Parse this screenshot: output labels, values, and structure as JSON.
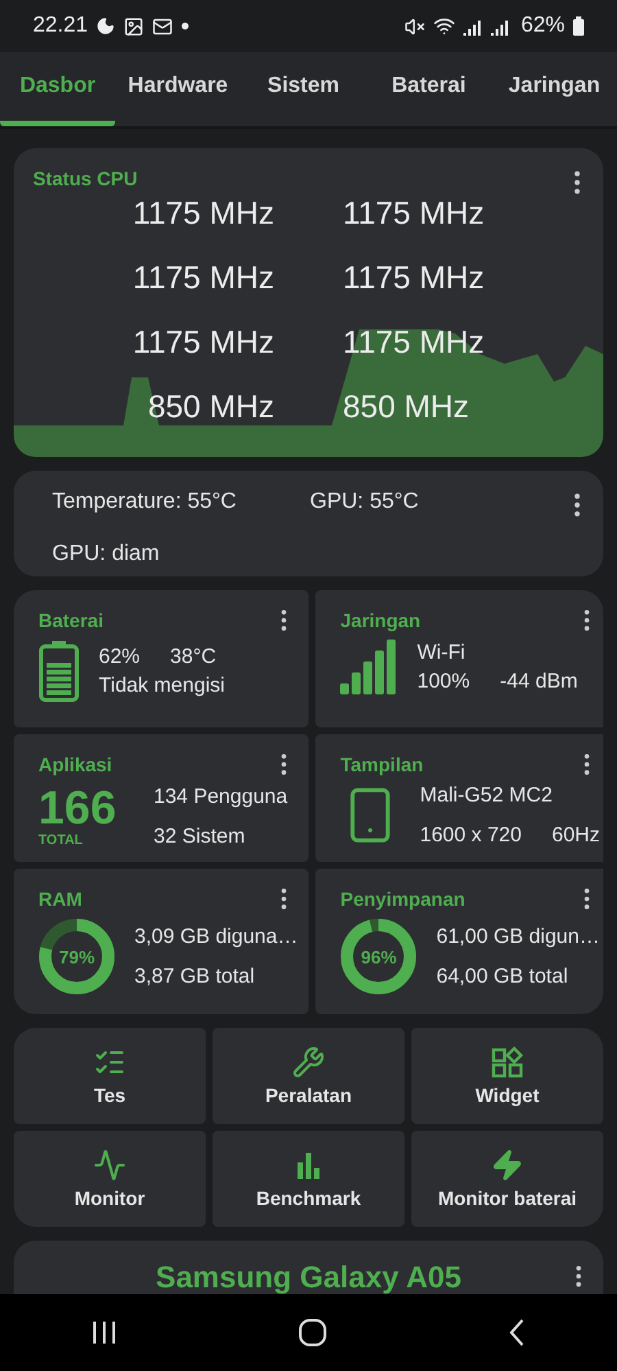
{
  "status_bar": {
    "time": "22.21",
    "battery": "62%"
  },
  "tabs": [
    {
      "label": "Dasbor",
      "selected": true
    },
    {
      "label": "Hardware",
      "selected": false
    },
    {
      "label": "Sistem",
      "selected": false
    },
    {
      "label": "Baterai",
      "selected": false
    },
    {
      "label": "Jaringan",
      "selected": false
    }
  ],
  "cpu_status": {
    "title": "Status CPU",
    "frequencies": [
      "1175 MHz",
      "1175 MHz",
      "1175 MHz",
      "1175 MHz",
      "1175 MHz",
      "1175 MHz",
      "850 MHz",
      "850 MHz"
    ]
  },
  "temperature": {
    "items": [
      "Temperature: 55°C",
      "GPU: 55°C",
      "GPU: diam"
    ]
  },
  "cards": [
    {
      "kind": "battery",
      "title": "Baterai",
      "lines": [
        [
          "62%",
          "38°C"
        ],
        [
          "Tidak mengisi"
        ]
      ]
    },
    {
      "kind": "network",
      "title": "Jaringan",
      "lines": [
        [
          "Wi-Fi"
        ],
        [
          "100%",
          "-44 dBm"
        ]
      ]
    },
    {
      "kind": "apps",
      "title": "Aplikasi",
      "count": "166",
      "count_label": "TOTAL",
      "lines": [
        [
          "134 Pengguna"
        ],
        [
          "32 Sistem"
        ]
      ]
    },
    {
      "kind": "display",
      "title": "Tampilan",
      "lines": [
        [
          "Mali-G52 MC2"
        ],
        [
          "1600 x 720",
          "60Hz"
        ]
      ]
    },
    {
      "kind": "donut",
      "title": "RAM",
      "level": 0.79,
      "percent": "79%",
      "lines": [
        [
          "3,09 GB diguna…"
        ],
        [
          "3,87 GB total"
        ]
      ]
    },
    {
      "kind": "donut",
      "title": "Penyimpanan",
      "level": 0.96,
      "percent": "96%",
      "lines": [
        [
          "61,00 GB digun…"
        ],
        [
          "64,00 GB total"
        ]
      ]
    }
  ],
  "shortcuts": [
    {
      "kind": "tests",
      "label": "Tes"
    },
    {
      "kind": "tools",
      "label": "Peralatan"
    },
    {
      "kind": "widgets",
      "label": "Widget"
    },
    {
      "kind": "monitor",
      "label": "Monitor"
    },
    {
      "kind": "benchmark",
      "label": "Benchmark"
    },
    {
      "kind": "battery_monitor",
      "label": "Monitor baterai"
    }
  ],
  "device": {
    "name": "Samsung Galaxy A05"
  }
}
